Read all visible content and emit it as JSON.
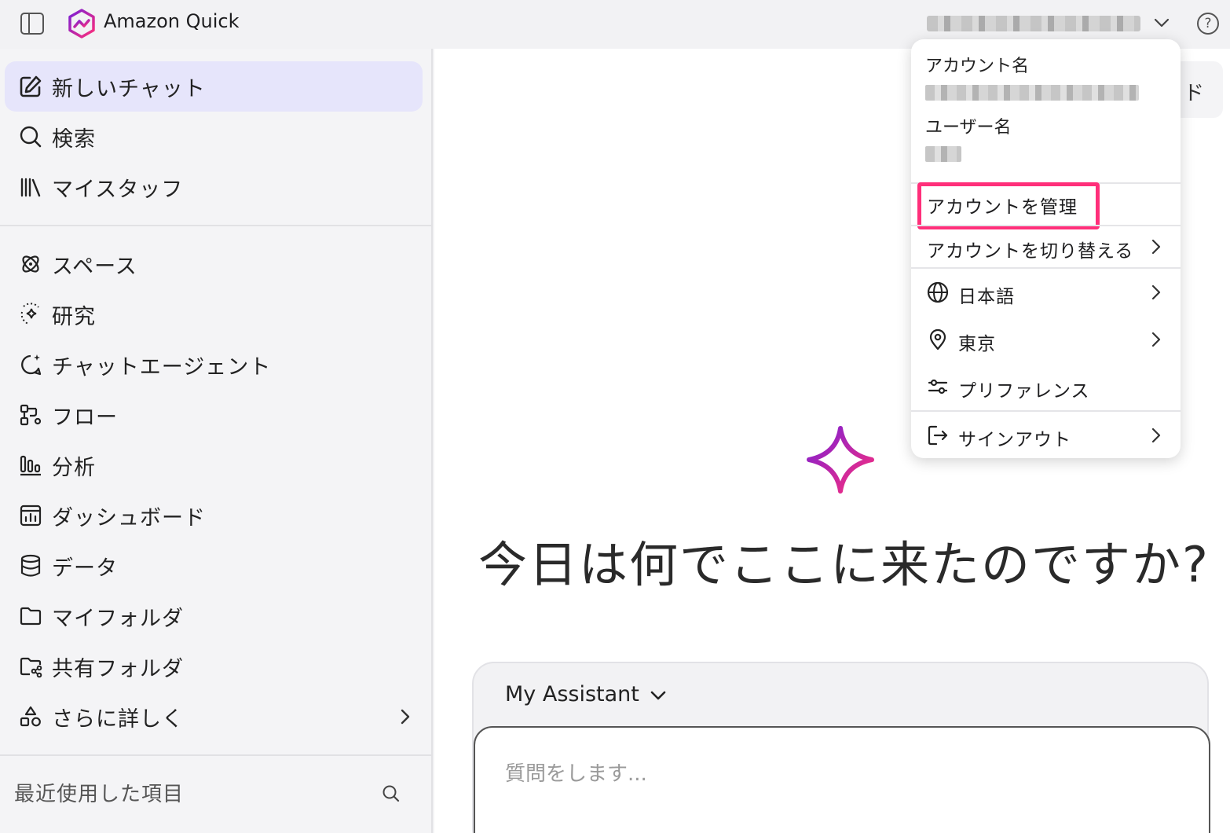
{
  "topbar": {
    "app_title": "Amazon Quick",
    "account_display": "",
    "help_glyph": "?"
  },
  "sidebar": {
    "items_top": [
      {
        "label": "新しいチャット",
        "icon": "edit-icon",
        "active": true
      },
      {
        "label": "検索",
        "icon": "search-icon"
      },
      {
        "label": "マイスタッフ",
        "icon": "library-icon"
      }
    ],
    "items_main": [
      {
        "label": "スペース",
        "icon": "spaces-icon"
      },
      {
        "label": "研究",
        "icon": "research-sparkle-icon"
      },
      {
        "label": "チャットエージェント",
        "icon": "chat-agent-icon"
      },
      {
        "label": "フロー",
        "icon": "flow-icon"
      },
      {
        "label": "分析",
        "icon": "analytics-icon"
      },
      {
        "label": "ダッシュボード",
        "icon": "dashboard-icon"
      },
      {
        "label": "データ",
        "icon": "database-icon"
      },
      {
        "label": "マイフォルダ",
        "icon": "folder-icon"
      },
      {
        "label": "共有フォルダ",
        "icon": "shared-folder-icon"
      },
      {
        "label": "さらに詳しく",
        "icon": "shapes-icon"
      }
    ],
    "recent_label": "最近使用した項目"
  },
  "main": {
    "behind_button_text": "ド",
    "greeting": "今日は何でここに来たのですか?",
    "assistant_label": "My Assistant",
    "chat_placeholder": "質問をします..."
  },
  "account_menu": {
    "account_name_caption": "アカウント名",
    "user_name_caption": "ユーザー名",
    "items": [
      {
        "label": "アカウントを管理",
        "highlighted": true
      },
      {
        "label": "アカウントを切り替える",
        "has_submenu": true
      },
      {
        "label": "日本語",
        "icon": "globe-icon",
        "has_submenu": true
      },
      {
        "label": "東京",
        "icon": "location-pin-icon",
        "has_submenu": true
      },
      {
        "label": "プリファレンス",
        "icon": "sliders-icon"
      },
      {
        "label": "サインアウト",
        "icon": "sign-out-icon",
        "has_submenu": true
      }
    ]
  },
  "colors": {
    "active_nav_bg": "#e6e5fb",
    "highlight_border": "#ff2f7a",
    "brand_gradient_start": "#7a1fd6",
    "brand_gradient_end": "#ff2f7a"
  }
}
